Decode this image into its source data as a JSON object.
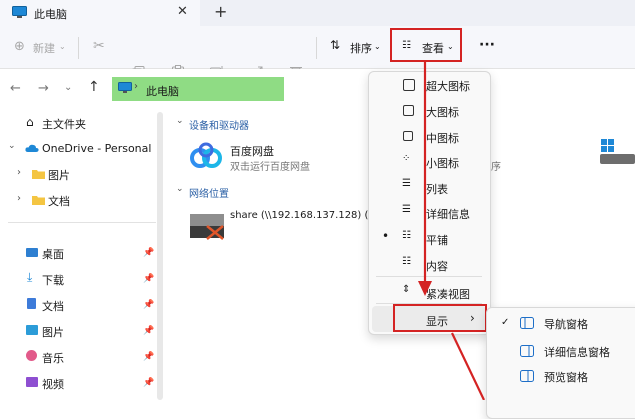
{
  "tab": {
    "title": "此电脑",
    "close": "✕",
    "new_tab": "+"
  },
  "toolbar": {
    "new_label": "新建",
    "sort_label": "排序",
    "view_label": "查看",
    "more": "···"
  },
  "address": {
    "path": "此电脑"
  },
  "sidebar": {
    "home": "主文件夹",
    "onedrive": "OneDrive - Personal",
    "pictures": "图片",
    "documents": "文档",
    "quick": [
      {
        "label": "桌面"
      },
      {
        "label": "下载"
      },
      {
        "label": "文档"
      },
      {
        "label": "图片"
      },
      {
        "label": "音乐"
      },
      {
        "label": "视频"
      }
    ]
  },
  "content": {
    "devices_title": "设备和驱动器",
    "baidu_name": "百度网盘",
    "baidu_sub": "双击运行百度网盘",
    "baidu_sub_tail": "程序",
    "network_title": "网络位置",
    "share_name": "share (\\\\192.168.137.128) (Z:)"
  },
  "view_menu": {
    "items": [
      {
        "label": "超大图标"
      },
      {
        "label": "大图标"
      },
      {
        "label": "中图标"
      },
      {
        "label": "小图标"
      },
      {
        "label": "列表"
      },
      {
        "label": "详细信息"
      },
      {
        "label": "平铺"
      },
      {
        "label": "内容"
      },
      {
        "label": "紧凑视图"
      }
    ],
    "show_label": "显示",
    "show_arrow": "›",
    "selected_bullet": "•"
  },
  "show_menu": {
    "items": [
      {
        "label": "导航窗格",
        "check": "✓"
      },
      {
        "label": "详细信息窗格"
      },
      {
        "label": "预览窗格"
      }
    ]
  },
  "colors": {
    "accent": "#2a5fa5",
    "highlight_red": "#d42323",
    "address_green": "#8fdc84"
  }
}
